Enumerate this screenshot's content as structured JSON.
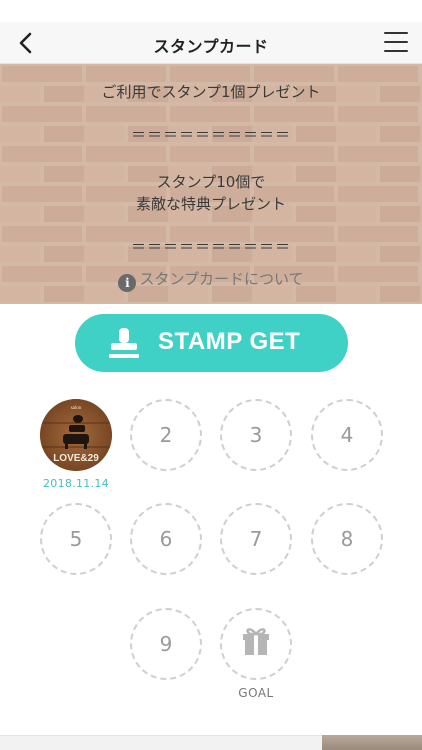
{
  "nav": {
    "title": "スタンプカード",
    "back_icon": "chevron-left-icon",
    "menu_icon": "hamburger-menu-icon"
  },
  "hero": {
    "line1": "ご利用でスタンプ1個プレゼント",
    "separator": "＝＝＝＝＝＝＝＝＝＝",
    "line2a": "スタンプ10個で",
    "line2b": "素敵な特典プレゼント",
    "about_icon_glyph": "i",
    "about_label": "スタンプカードについて"
  },
  "stamp_button": {
    "label": "STAMP GET",
    "icon": "stamp-icon",
    "color": "#3fd1c5"
  },
  "card": {
    "first_stamp_date": "2018.11.14",
    "first_stamp_text": "LOVE&29",
    "first_stamp_top_text": "salon",
    "slots": [
      "2",
      "3",
      "4",
      "5",
      "6",
      "7",
      "8",
      "9"
    ],
    "goal_label": "GOAL",
    "goal_icon": "gift-icon",
    "date_color": "#3fc1c2"
  }
}
